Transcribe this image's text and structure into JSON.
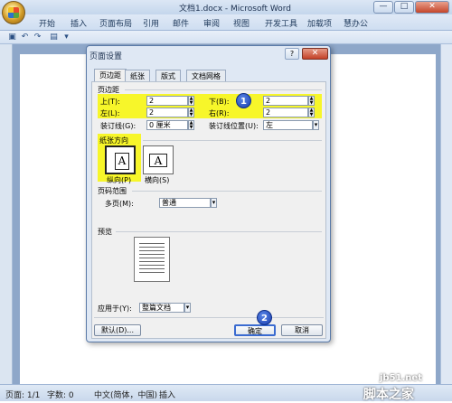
{
  "window": {
    "title": "文档1.docx - Microsoft Word",
    "minimize": "—",
    "maximize": "□",
    "close": "✕"
  },
  "ribbon_tabs": [
    "开始",
    "插入",
    "页面布局",
    "引用",
    "邮件",
    "审阅",
    "视图",
    "开发工具",
    "加载项",
    "慧办公"
  ],
  "dialog": {
    "title": "页面设置",
    "help": "?",
    "close": "✕",
    "tabs": [
      "页边距",
      "纸张",
      "版式",
      "文档网格"
    ],
    "margins_label": "页边距",
    "top_label": "上(T):",
    "top_value": "2",
    "bottom_label": "下(B):",
    "bottom_value": "2",
    "left_label": "左(L):",
    "left_value": "2",
    "right_label": "右(R):",
    "right_value": "2",
    "gutter_label": "装订线(G):",
    "gutter_value": "0 厘米",
    "gutter_pos_label": "装订线位置(U):",
    "gutter_pos_value": "左",
    "orientation_label": "纸张方向",
    "portrait_label": "纵向(P)",
    "landscape_label": "横向(S)",
    "page_range_label": "页码范围",
    "multiple_pages_label": "多页(M):",
    "multiple_pages_value": "普通",
    "preview_label": "预览",
    "apply_to_label": "应用于(Y):",
    "apply_to_value": "整篇文档",
    "default_button": "默认(D)...",
    "ok_button": "确定",
    "cancel_button": "取消",
    "badge1": "1",
    "badge2": "2",
    "glyph": "A"
  },
  "status": {
    "page": "页面: 1/1",
    "words": "字数: 0",
    "language": "中文(简体，中国)",
    "mode": "插入"
  },
  "watermark": {
    "line1": "jb51.net",
    "line2": "脚本之家"
  }
}
